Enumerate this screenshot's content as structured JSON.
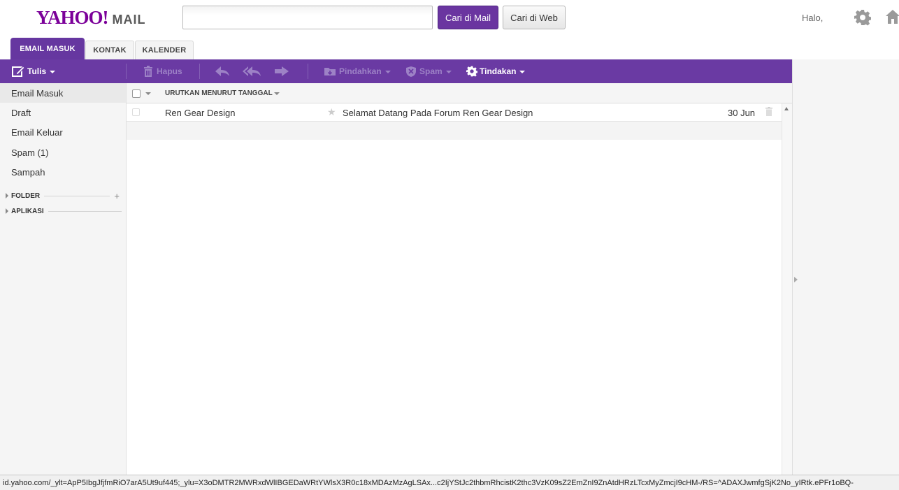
{
  "header": {
    "logo_text": "YAHOO!",
    "logo_sub": "MAIL",
    "search_placeholder": "",
    "search_mail_label": "Cari di Mail",
    "search_web_label": "Cari di Web",
    "greeting": "Halo,"
  },
  "tabs": [
    {
      "label": "EMAIL MASUK",
      "active": true
    },
    {
      "label": "KONTAK",
      "active": false
    },
    {
      "label": "KALENDER",
      "active": false
    }
  ],
  "toolbar": {
    "compose": "Tulis",
    "delete": "Hapus",
    "move": "Pindahkan",
    "spam": "Spam",
    "actions": "Tindakan"
  },
  "sidebar": {
    "items": [
      {
        "label": "Email Masuk",
        "selected": true
      },
      {
        "label": "Draft"
      },
      {
        "label": "Email Keluar"
      },
      {
        "label": "Spam (1)"
      },
      {
        "label": "Sampah"
      }
    ],
    "sections": [
      "FOLDER",
      "APLIKASI"
    ]
  },
  "list": {
    "sort_label": "URUTKAN MENURUT TANGGAL",
    "emails": [
      {
        "sender": "Ren Gear Design",
        "subject": "Selamat Datang Pada Forum Ren Gear Design",
        "date": "30 Jun"
      }
    ]
  },
  "status_url": "id.yahoo.com/_ylt=ApP5IbgJfjfmRiO7arA5Ut9uf445;_ylu=X3oDMTR2MWRxdWlIBGEDaWRtYWlsX3R0c18xMDAzMzAgLSAx...c2IjYStJc2thbmRhcistK2thc3VzK09sZ2EmZnI9ZnAtdHRzLTcxMyZmcjI9cHM-/RS=^ADAXJwmfgSjK2No_yIRtk.ePFr1oBQ-",
  "colors": {
    "brand_purple": "#6a3aa3",
    "logo_purple": "#7b0099"
  },
  "icons": [
    "compose-icon",
    "trash-icon",
    "reply-icon",
    "reply-all-icon",
    "forward-icon",
    "move-icon",
    "spam-shield-icon",
    "gear-icon",
    "home-icon",
    "star-icon"
  ]
}
